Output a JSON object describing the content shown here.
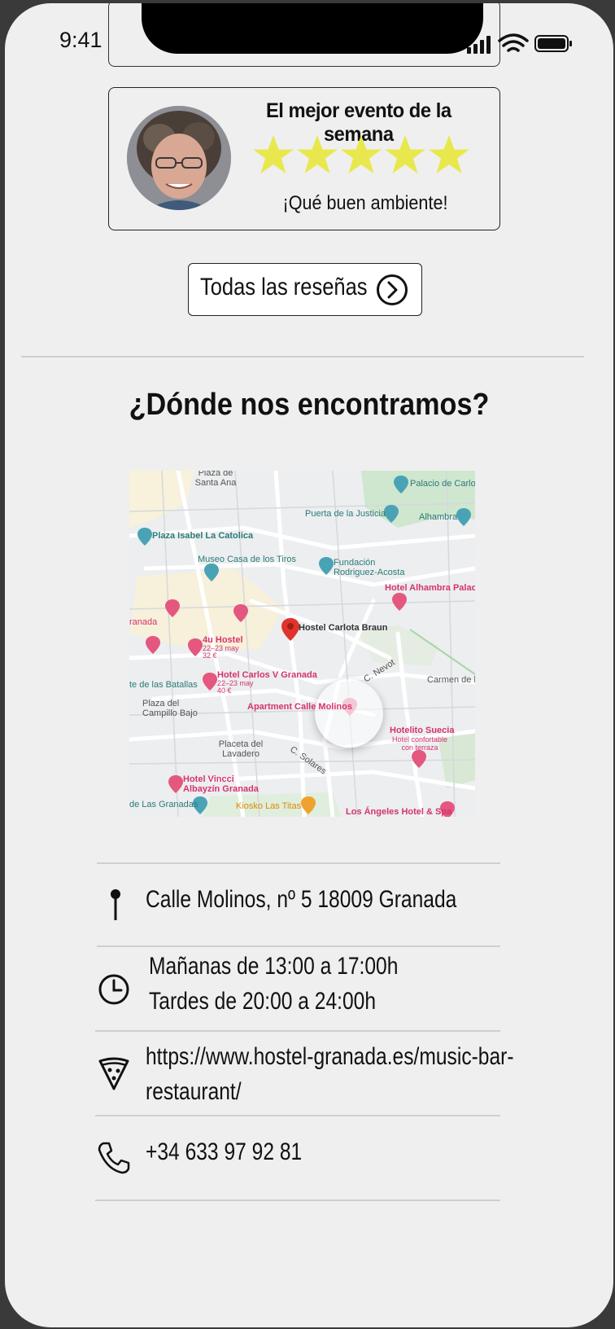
{
  "status_bar": {
    "time": "9:41"
  },
  "review": {
    "title": "El mejor evento de la semana",
    "rating": 5,
    "max_rating": 5,
    "star_color": "#e8e84e",
    "text": "¡Qué buen ambiente!"
  },
  "reviews_button": {
    "label": "Todas las reseñas",
    "icon": "chevron-right-circle-icon"
  },
  "location_section": {
    "title": "¿Dónde nos encontramos?"
  },
  "map": {
    "labels": {
      "plaza_santa_ana": "Plaza de Santa Ana",
      "palacio": "Palacio de Carlos",
      "puerta_justicia": "Puerta de la Justicia",
      "alhambra": "Alhambra",
      "plaza_isabel": "Plaza Isabel La Catolica",
      "museo": "Museo Casa de los Tiros",
      "fundacion": "Fundación Rodriguez-Acosta",
      "hotel_alhambra": "Hotel Alhambra Palace",
      "granada": "ranada",
      "hostel_carlota": "Hostel Carlota Braun",
      "hostel_4u": "4u Hostel",
      "hostel_4u_date": "22–23 may",
      "hostel_4u_price": "32 €",
      "calle_nevot": "C. Nevot",
      "carmen": "Carmen de l",
      "batallas": "te de las Batallas",
      "hotel_carlos": "Hotel Carlos V Granada",
      "hotel_carlos_date": "22–23 may",
      "hotel_carlos_price": "40 €",
      "plaza_campillo": "Plaza del Campillo Bajo",
      "apartment": "Apartment Calle Molinos",
      "hotelito": "Hotelito Suecia",
      "hotelito_sub": "Hotel confortable con terraza",
      "placeta": "Placeta del Lavadero",
      "solares": "C. Solares",
      "hotel_vincci": "Hotel Vincci Albayzín Granada",
      "las_granadas": "de Las Granadas",
      "kiosko": "Kiosko Las Titas",
      "los_angeles": "Los Ángeles Hotel & Spa"
    }
  },
  "info": {
    "address": {
      "icon": "pin-icon",
      "text": "Calle Molinos, nº 5 18009 Granada"
    },
    "hours": {
      "icon": "clock-icon",
      "line1": "Mañanas de 13:00 a 17:00h",
      "line2": "Tardes de 20:00 a 24:00h"
    },
    "website": {
      "icon": "pizza-icon",
      "line1": "https://www.hostel-granada.es/music-bar-",
      "line2": "restaurant/"
    },
    "phone": {
      "icon": "phone-icon",
      "text": "+34 633 97 92 81"
    }
  }
}
